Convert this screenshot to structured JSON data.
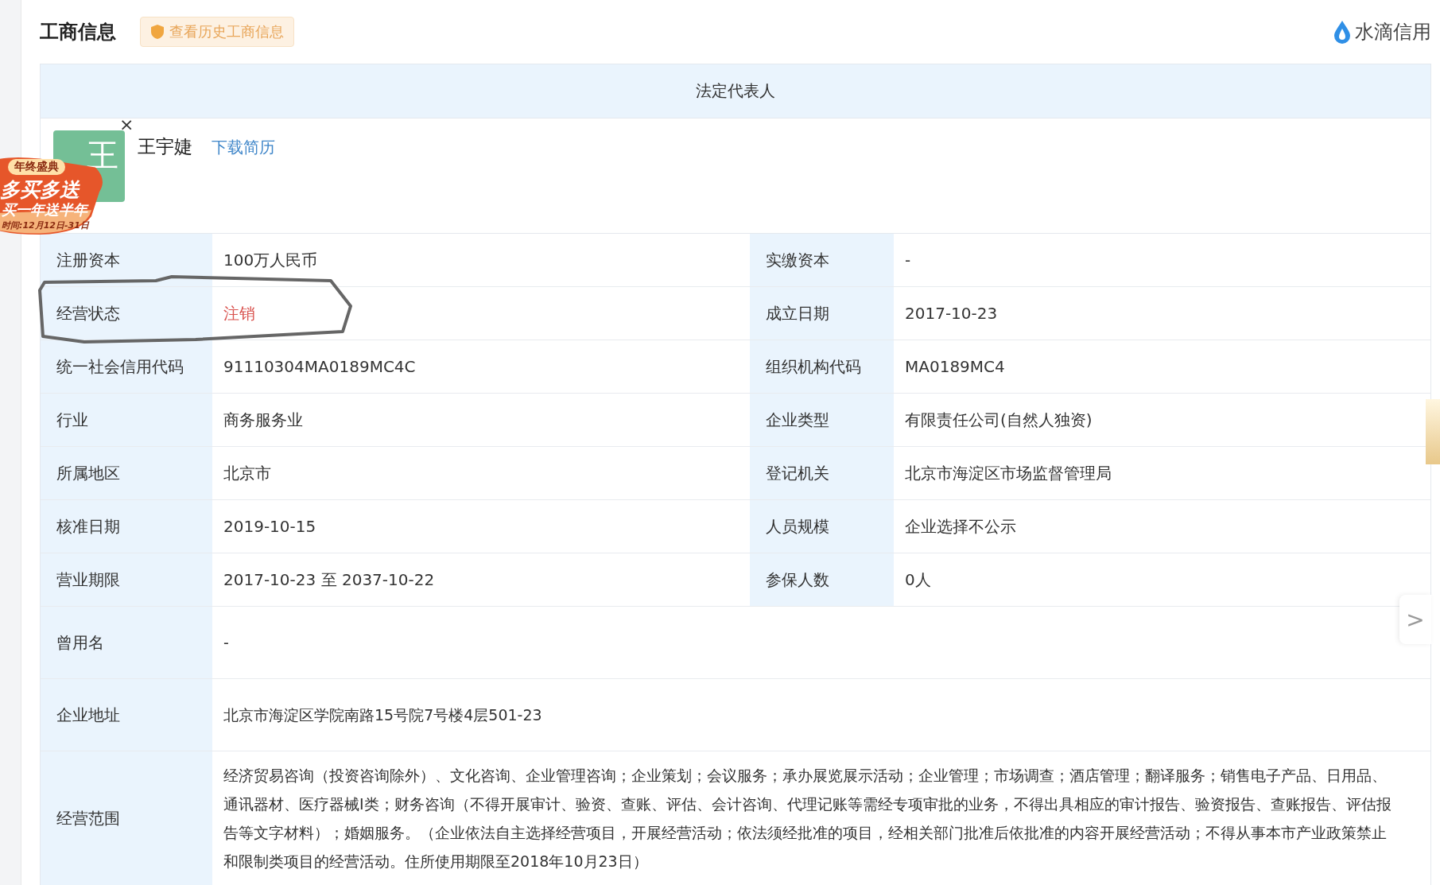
{
  "header": {
    "title": "工商信息",
    "history_button": "查看历史工商信息",
    "brand": "水滴信用"
  },
  "legal_rep": {
    "heading": "法定代表人",
    "avatar_letter": "王",
    "name": "王宇婕",
    "resume_link": "下载简历"
  },
  "promo": {
    "tag": "年终盛典",
    "headline": "多买多送",
    "subline": "买一年送半年",
    "period": "时间:12月12日-31日",
    "close": "×"
  },
  "rows": [
    {
      "kind": "pair",
      "cells": [
        {
          "label": "注册资本",
          "value": "100万人民币",
          "alert": false
        },
        {
          "label": "实缴资本",
          "value": "-",
          "alert": false
        }
      ]
    },
    {
      "kind": "pair",
      "cells": [
        {
          "label": "经营状态",
          "value": "注销",
          "alert": true
        },
        {
          "label": "成立日期",
          "value": "2017-10-23",
          "alert": false
        }
      ]
    },
    {
      "kind": "pair",
      "cells": [
        {
          "label": "统一社会信用代码",
          "value": "91110304MA0189MC4C",
          "alert": false
        },
        {
          "label": "组织机构代码",
          "value": "MA0189MC4",
          "alert": false
        }
      ]
    },
    {
      "kind": "pair",
      "cells": [
        {
          "label": "行业",
          "value": "商务服务业",
          "alert": false
        },
        {
          "label": "企业类型",
          "value": "有限责任公司(自然人独资)",
          "alert": false
        }
      ]
    },
    {
      "kind": "pair",
      "cells": [
        {
          "label": "所属地区",
          "value": "北京市",
          "alert": false
        },
        {
          "label": "登记机关",
          "value": "北京市海淀区市场监督管理局",
          "alert": false
        }
      ]
    },
    {
      "kind": "pair",
      "cells": [
        {
          "label": "核准日期",
          "value": "2019-10-15",
          "alert": false
        },
        {
          "label": "人员规模",
          "value": "企业选择不公示",
          "alert": false
        }
      ]
    },
    {
      "kind": "pair",
      "cells": [
        {
          "label": "营业期限",
          "value": "2017-10-23 至 2037-10-22",
          "alert": false
        },
        {
          "label": "参保人数",
          "value": "0人",
          "alert": false
        }
      ]
    },
    {
      "kind": "full",
      "cells": [
        {
          "label": "曾用名",
          "value": "-",
          "alert": false
        }
      ]
    },
    {
      "kind": "full",
      "cells": [
        {
          "label": "企业地址",
          "value": "北京市海淀区学院南路15号院7号楼4层501-23",
          "alert": false
        }
      ]
    },
    {
      "kind": "full",
      "cells": [
        {
          "label": "经营范围",
          "value": "经济贸易咨询（投资咨询除外）、文化咨询、企业管理咨询；企业策划；会议服务；承办展览展示活动；企业管理；市场调查；酒店管理；翻译服务；销售电子产品、日用品、通讯器材、医疗器械Ⅰ类；财务咨询（不得开展审计、验资、查账、评估、会计咨询、代理记账等需经专项审批的业务，不得出具相应的审计报告、验资报告、查账报告、评估报告等文字材料）；婚姻服务。（企业依法自主选择经营项目，开展经营活动；依法须经批准的项目，经相关部门批准后依批准的内容开展经营活动；不得从事本市产业政策禁止和限制类项目的经营活动。住所使用期限至2018年10月23日）",
          "alert": false
        }
      ]
    }
  ],
  "side_button": ">"
}
